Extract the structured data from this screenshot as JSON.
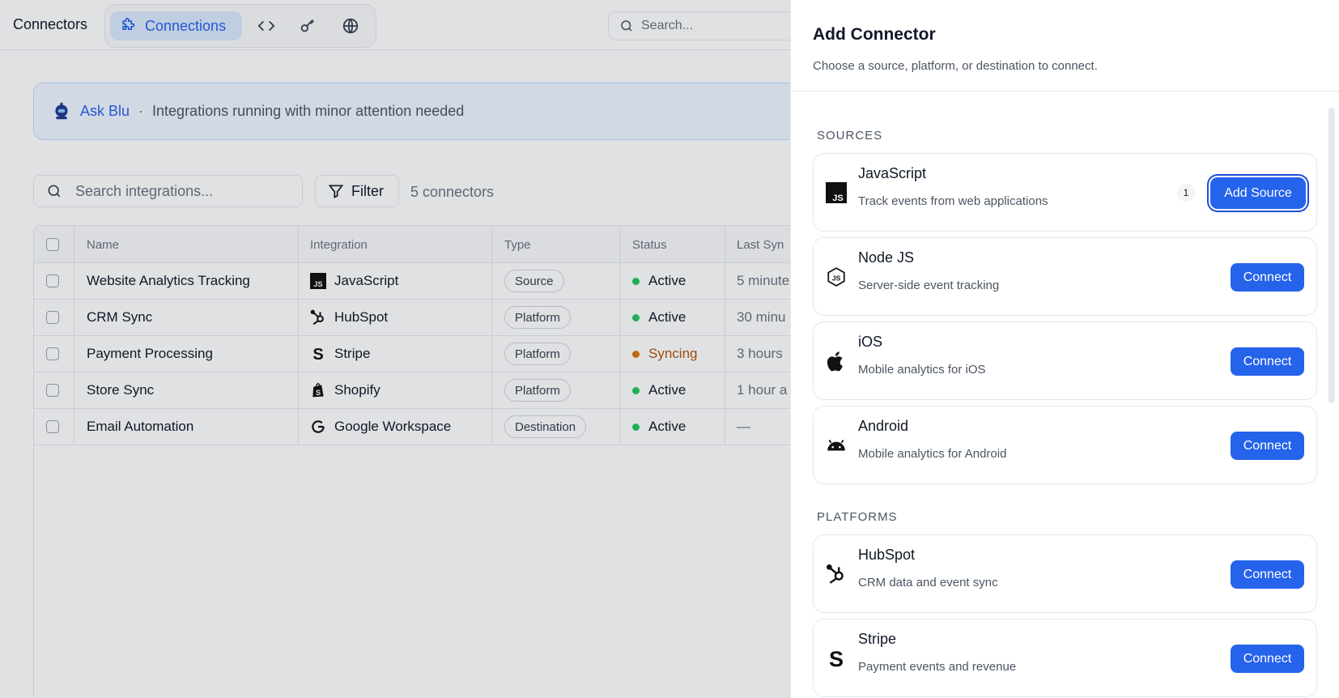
{
  "header": {
    "app_title": "Connectors",
    "active_tab": "Connections",
    "search_placeholder": "Search..."
  },
  "banner": {
    "ask_label": "Ask Blu",
    "separator": "·",
    "message": "Integrations running with minor attention needed"
  },
  "toolbar": {
    "search_placeholder": "Search integrations...",
    "filter_label": "Filter",
    "count_label": "5 connectors"
  },
  "table": {
    "columns": [
      "Name",
      "Integration",
      "Type",
      "Status",
      "Last Syn"
    ],
    "rows": [
      {
        "name": "Website Analytics Tracking",
        "integration": "JavaScript",
        "icon": "javascript-icon",
        "type": "Source",
        "status": "Active",
        "status_color": "#22c55e",
        "last_sync": "5 minute"
      },
      {
        "name": "CRM Sync",
        "integration": "HubSpot",
        "icon": "hubspot-icon",
        "type": "Platform",
        "status": "Active",
        "status_color": "#22c55e",
        "last_sync": "30 minu"
      },
      {
        "name": "Payment Processing",
        "integration": "Stripe",
        "icon": "stripe-icon",
        "type": "Platform",
        "status": "Syncing",
        "status_color": "#d97706",
        "last_sync": "3 hours"
      },
      {
        "name": "Store Sync",
        "integration": "Shopify",
        "icon": "shopify-icon",
        "type": "Platform",
        "status": "Active",
        "status_color": "#22c55e",
        "last_sync": "1 hour a"
      },
      {
        "name": "Email Automation",
        "integration": "Google Workspace",
        "icon": "google-icon",
        "type": "Destination",
        "status": "Active",
        "status_color": "#22c55e",
        "last_sync": "—"
      }
    ]
  },
  "panel": {
    "title": "Add Connector",
    "subtitle": "Choose a source, platform, or destination to connect.",
    "sections": [
      {
        "label": "SOURCES",
        "items": [
          {
            "title": "JavaScript",
            "description": "Track events from web applications",
            "icon": "javascript-icon",
            "count": "1",
            "button": "Add Source"
          },
          {
            "title": "Node JS",
            "description": "Server-side event tracking",
            "icon": "nodejs-icon",
            "button": "Connect"
          },
          {
            "title": "iOS",
            "description": "Mobile analytics for iOS",
            "icon": "apple-icon",
            "button": "Connect"
          },
          {
            "title": "Android",
            "description": "Mobile analytics for Android",
            "icon": "android-icon",
            "button": "Connect"
          }
        ]
      },
      {
        "label": "PLATFORMS",
        "items": [
          {
            "title": "HubSpot",
            "description": "CRM data and event sync",
            "icon": "hubspot-icon",
            "button": "Connect"
          },
          {
            "title": "Stripe",
            "description": "Payment events and revenue",
            "icon": "stripe-icon",
            "button": "Connect"
          }
        ]
      }
    ]
  },
  "colors": {
    "accent": "#2563eb",
    "active": "#22c55e",
    "syncing": "#d97706"
  }
}
